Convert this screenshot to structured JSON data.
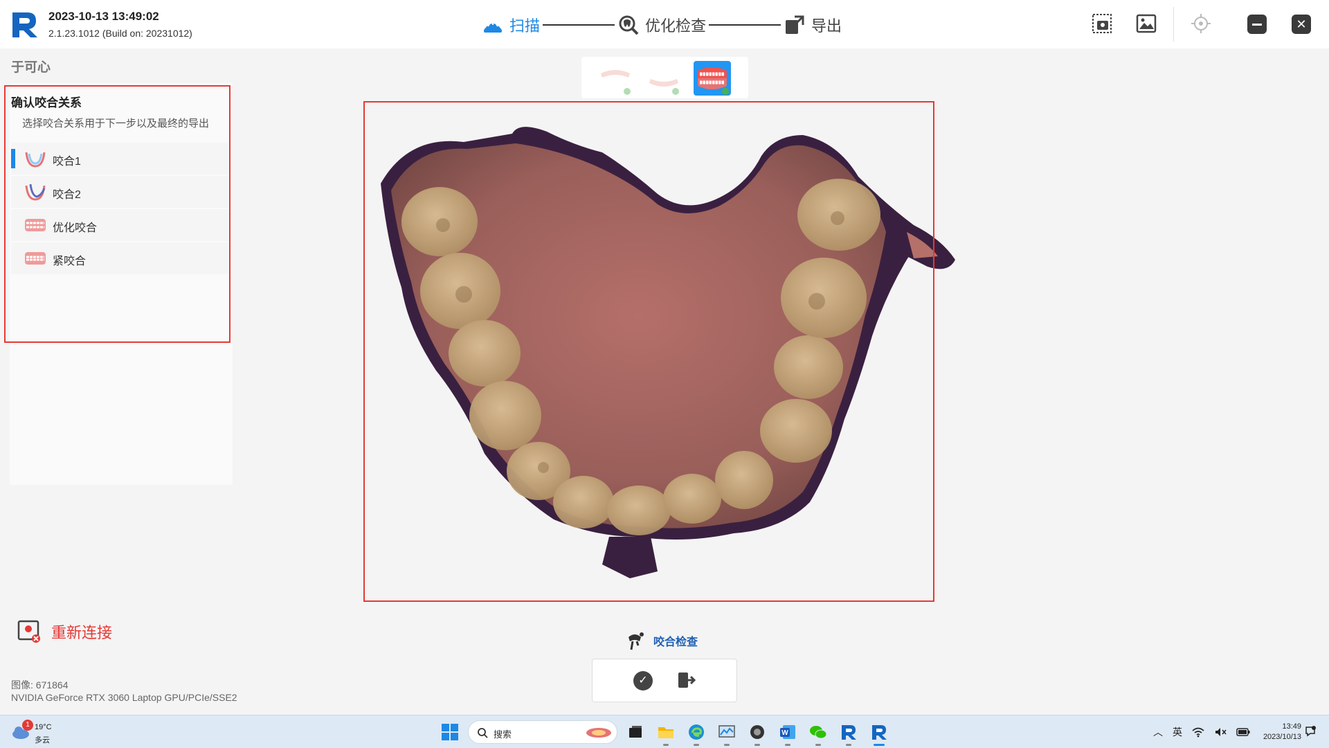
{
  "header": {
    "datetime": "2023-10-13 13:49:02",
    "version": "2.1.23.1012 (Build on: 20231012)",
    "steps": [
      {
        "label": "扫描",
        "active": true
      },
      {
        "label": "优化检查",
        "active": false
      },
      {
        "label": "导出",
        "active": false
      }
    ],
    "icons": [
      "screenshot-icon",
      "image-icon",
      "target-icon",
      "minimize-icon",
      "close-icon"
    ]
  },
  "patient": {
    "name": "于可心"
  },
  "occlusion": {
    "title": "确认咬合关系",
    "subtitle": "选择咬合关系用于下一步以及最终的导出",
    "items": [
      {
        "label": "咬合1",
        "selected": true
      },
      {
        "label": "咬合2",
        "selected": false
      },
      {
        "label": "优化咬合",
        "selected": false
      },
      {
        "label": "紧咬合",
        "selected": false
      }
    ]
  },
  "reconnect": {
    "label": "重新连接"
  },
  "status": {
    "image_count": "图像: 671864",
    "gpu": "NVIDIA GeForce RTX 3060 Laptop GPU/PCIe/SSE2"
  },
  "tools": {
    "occlusion_check_label": "咬合检查"
  },
  "colors": {
    "accent": "#1e88e5",
    "alert": "#e53935",
    "tissue": "#b5706a",
    "tooth": "#d2b48a"
  },
  "taskbar": {
    "weather_temp": "19°C",
    "weather_cond": "多云",
    "weather_badge": "1",
    "search_placeholder": "搜索",
    "ime": "英",
    "time": "13:49",
    "date": "2023/10/13"
  }
}
